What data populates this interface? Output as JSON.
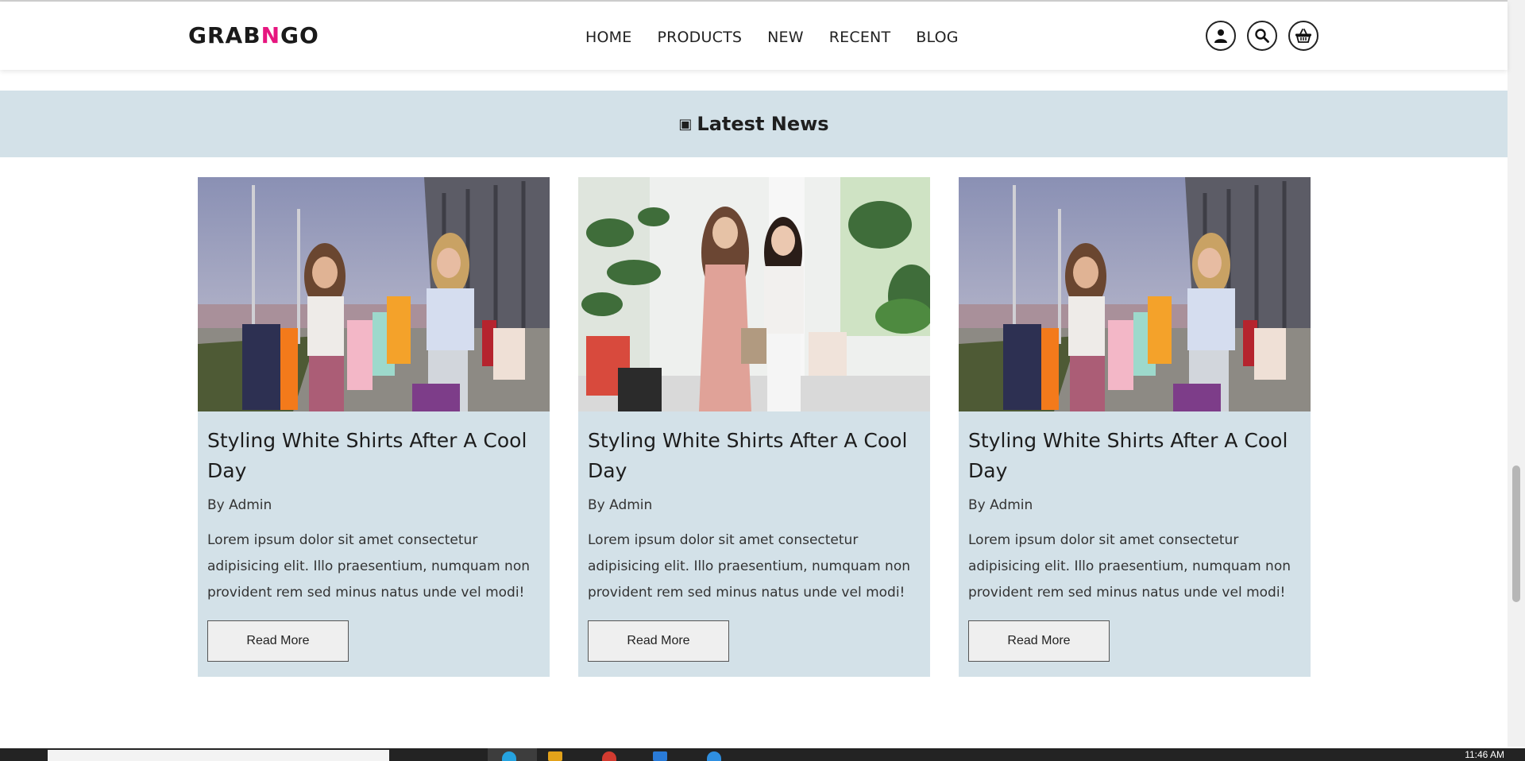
{
  "brand": {
    "logo_part1": "GRAB",
    "logo_accent": "N",
    "logo_part2": "GO",
    "accent_color": "#e6167f"
  },
  "nav": {
    "links": [
      "HOME",
      "PRODUCTS",
      "NEW",
      "RECENT",
      "BLOG"
    ],
    "icons": [
      "user-icon",
      "search-icon",
      "basket-icon"
    ]
  },
  "news": {
    "heading_icon": "▣",
    "heading": "Latest News",
    "band_color": "#d3e1e8",
    "cards": [
      {
        "image": "two-women-with-shopping-bags-street",
        "title": "Styling White Shirts After A Cool Day",
        "author": "By Admin",
        "text": "Lorem ipsum dolor sit amet consectetur adipisicing elit. Illo praesentium, numquam non provident rem sed minus natus unde vel modi!",
        "button": "Read More"
      },
      {
        "image": "two-women-with-shopping-bags-mall",
        "title": "Styling White Shirts After A Cool Day",
        "author": "By Admin",
        "text": "Lorem ipsum dolor sit amet consectetur adipisicing elit. Illo praesentium, numquam non provident rem sed minus natus unde vel modi!",
        "button": "Read More"
      },
      {
        "image": "two-women-with-shopping-bags-street",
        "title": "Styling White Shirts After A Cool Day",
        "author": "By Admin",
        "text": "Lorem ipsum dolor sit amet consectetur adipisicing elit. Illo praesentium, numquam non provident rem sed minus natus unde vel modi!",
        "button": "Read More"
      }
    ]
  },
  "taskbar": {
    "time": "11:46 AM"
  }
}
